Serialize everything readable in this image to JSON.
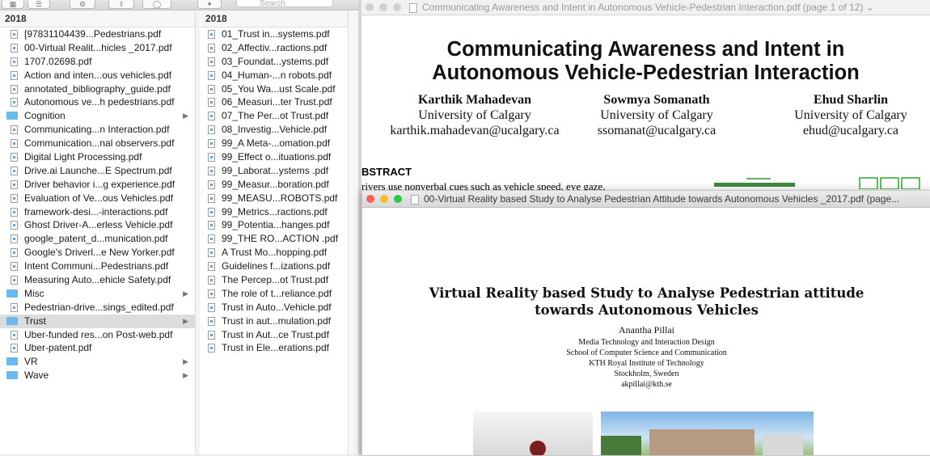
{
  "finder": {
    "search_placeholder": "Search",
    "col1": {
      "header": "2018",
      "items": [
        {
          "label": "[97831104439...Pedestrians.pdf",
          "kind": "pdf"
        },
        {
          "label": "00-Virtual Realit...hicles _2017.pdf",
          "kind": "pdf"
        },
        {
          "label": "1707.02698.pdf",
          "kind": "pdf"
        },
        {
          "label": "Action and inten...ous vehicles.pdf",
          "kind": "pdf"
        },
        {
          "label": "annotated_bibliography_guide.pdf",
          "kind": "pdf"
        },
        {
          "label": "Autonomous ve...h pedestrians.pdf",
          "kind": "pdf"
        },
        {
          "label": "Cognition",
          "kind": "folder"
        },
        {
          "label": "Communicating...n Interaction.pdf",
          "kind": "pdf"
        },
        {
          "label": "Communication...nal observers.pdf",
          "kind": "pdf"
        },
        {
          "label": "Digital Light Processing.pdf",
          "kind": "pdf"
        },
        {
          "label": "Drive.ai Launche...E Spectrum.pdf",
          "kind": "pdf"
        },
        {
          "label": "Driver behavior i...g experience.pdf",
          "kind": "pdf"
        },
        {
          "label": "Evaluation of Ve...ous Vehicles.pdf",
          "kind": "pdf"
        },
        {
          "label": "framework-desi...-interactions.pdf",
          "kind": "pdf"
        },
        {
          "label": "Ghost Driver-A...erless Vehicle.pdf",
          "kind": "pdf"
        },
        {
          "label": "google_patent_d...munication.pdf",
          "kind": "pdf"
        },
        {
          "label": "Google's Driverl...e New Yorker.pdf",
          "kind": "pdf"
        },
        {
          "label": "Intent Communi...Pedestrians.pdf",
          "kind": "pdf"
        },
        {
          "label": "Measuring Auto...ehicle Safety.pdf",
          "kind": "pdf"
        },
        {
          "label": "Misc",
          "kind": "folder"
        },
        {
          "label": "Pedestrian-drive...sings_edited.pdf",
          "kind": "pdf"
        },
        {
          "label": "Trust",
          "kind": "folder",
          "selected": true
        },
        {
          "label": "Uber-funded res...on Post-web.pdf",
          "kind": "pdf"
        },
        {
          "label": "Uber-patent.pdf",
          "kind": "pdf"
        },
        {
          "label": "VR",
          "kind": "folder"
        },
        {
          "label": "Wave",
          "kind": "folder"
        }
      ]
    },
    "col2": {
      "header": "2018",
      "items": [
        "01_Trust in...systems.pdf",
        "02_Affectiv...ractions.pdf",
        "03_Foundat...ystems.pdf",
        "04_Human-...n robots.pdf",
        "05_You Wa...ust Scale.pdf",
        "06_Measuri...ter Trust.pdf",
        "07_The Per...ot Trust.pdf",
        "08_Investig...Vehicle.pdf",
        "99_A Meta-...omation.pdf",
        "99_Effect o...ituations.pdf",
        "99_Laborat...ystems .pdf",
        "99_Measur...boration.pdf",
        "99_MEASU...ROBOTS.pdf",
        "99_Metrics...ractions.pdf",
        "99_Potentia...hanges.pdf",
        "99_THE RO...ACTION .pdf",
        "A Trust Mo...hopping.pdf",
        "Guidelines f...izations.pdf",
        "The Percep...ot Trust.pdf",
        "The role of t...reliance.pdf",
        "Trust in Auto...Vehicle.pdf",
        "Trust in aut...mulation.pdf",
        "Trust in Aut...ce Trust.pdf",
        "Trust in Ele...erations.pdf"
      ]
    }
  },
  "doc1": {
    "window_title": "Communicating Awareness and Intent in Autonomous Vehicle-Pedestrian Interaction.pdf (page 1 of 12) ⌄",
    "title_line1": "Communicating Awareness and Intent in",
    "title_line2": "Autonomous Vehicle-Pedestrian Interaction",
    "authors": [
      {
        "name": "Karthik Mahadevan",
        "affil": "University of Calgary",
        "email": "karthik.mahadevan@ucalgary.ca"
      },
      {
        "name": "Sowmya Somanath",
        "affil": "University of Calgary",
        "email": "ssomanat@ucalgary.ca"
      },
      {
        "name": "Ehud Sharlin",
        "affil": "University of Calgary",
        "email": "ehud@ucalgary.ca"
      }
    ],
    "abstract_heading": "BSTRACT",
    "abstract_text": "rivers use nonverbal cues such as vehicle speed, eye gaze,"
  },
  "doc2": {
    "window_title": "00-Virtual Reality based Study to Analyse Pedestrian  Attitude towards Autonomous Vehicles _2017.pdf (page...",
    "title_line1": "Virtual Reality based Study to Analyse Pedestrian attitude",
    "title_line2": "towards Autonomous Vehicles",
    "author": "Anantha Pillai",
    "affil1": "Media Technology and Interaction Design",
    "affil2": "School of Computer Science and Communication",
    "affil3": "KTH Royal Institute of Technology",
    "affil4": "Stockholm, Sweden",
    "email": "akpillai@kth.se"
  }
}
